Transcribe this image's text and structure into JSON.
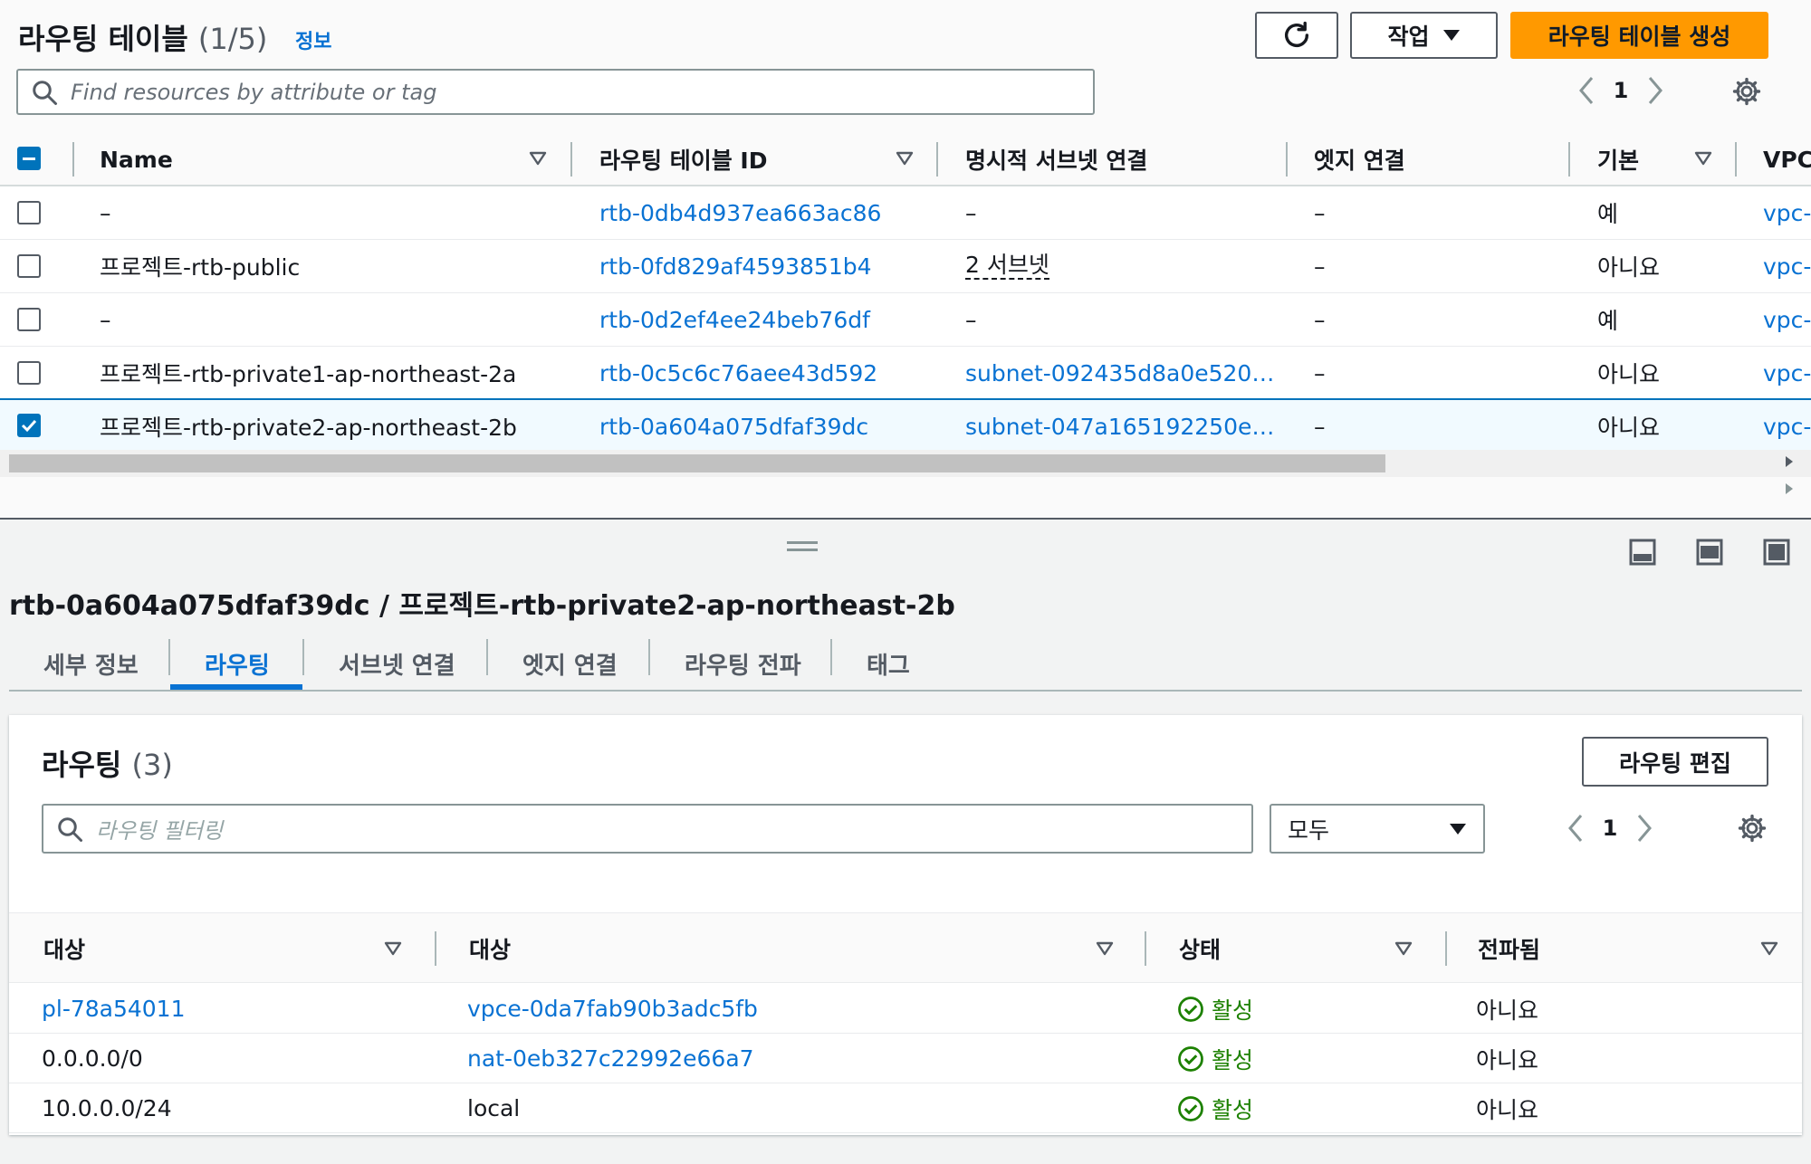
{
  "top": {
    "title": "라우팅 테이블",
    "count": "(1/5)",
    "info": "정보",
    "actions_label": "작업",
    "create_label": "라우팅 테이블 생성",
    "search_placeholder": "Find resources by attribute or tag",
    "page": "1"
  },
  "table": {
    "columns": [
      "Name",
      "라우팅 테이블 ID",
      "명시적 서브넷 연결",
      "엣지 연결",
      "기본",
      "VPC"
    ],
    "rows": [
      {
        "name": "–",
        "id": "rtb-0db4d937ea663ac86",
        "subnet": "–",
        "edge": "–",
        "main": "예",
        "vpc": "vpc-",
        "selected": false
      },
      {
        "name": "프로젝트-rtb-public",
        "id": "rtb-0fd829af4593851b4",
        "subnet": "2 서브넷",
        "edge": "–",
        "main": "아니요",
        "vpc": "vpc-",
        "selected": false
      },
      {
        "name": "–",
        "id": "rtb-0d2ef4ee24beb76df",
        "subnet": "–",
        "edge": "–",
        "main": "예",
        "vpc": "vpc-",
        "selected": false
      },
      {
        "name": "프로젝트-rtb-private1-ap-northeast-2a",
        "id": "rtb-0c5c6c76aee43d592",
        "subnet": "subnet-092435d8a0e520…",
        "edge": "–",
        "main": "아니요",
        "vpc": "vpc-",
        "selected": false
      },
      {
        "name": "프로젝트-rtb-private2-ap-northeast-2b",
        "id": "rtb-0a604a075dfaf39dc",
        "subnet": "subnet-047a165192250e…",
        "edge": "–",
        "main": "아니요",
        "vpc": "vpc-",
        "selected": true
      }
    ]
  },
  "detail": {
    "title": "rtb-0a604a075dfaf39dc / 프로젝트-rtb-private2-ap-northeast-2b",
    "tabs": [
      "세부 정보",
      "라우팅",
      "서브넷 연결",
      "엣지 연결",
      "라우팅 전파",
      "태그"
    ],
    "active_tab": "라우팅"
  },
  "routes": {
    "title": "라우팅",
    "count": "(3)",
    "edit_label": "라우팅 편집",
    "filter_placeholder": "라우팅 필터링",
    "select_value": "모두",
    "page": "1",
    "columns": [
      "대상",
      "대상",
      "상태",
      "전파됨"
    ],
    "rows": [
      {
        "destination": "pl-78a54011",
        "target": "vpce-0da7fab90b3adc5fb",
        "status": "활성",
        "propagated": "아니요"
      },
      {
        "destination": "0.0.0.0/0",
        "target": "nat-0eb327c22992e66a7",
        "status": "활성",
        "propagated": "아니요"
      },
      {
        "destination": "10.0.0.0/24",
        "target": "local",
        "status": "활성",
        "propagated": "아니요"
      }
    ]
  },
  "colors": {
    "link": "#0972d3",
    "primary_button": "#ff9900",
    "selected_row": "#f1faff",
    "status_active": "#1d8102"
  }
}
